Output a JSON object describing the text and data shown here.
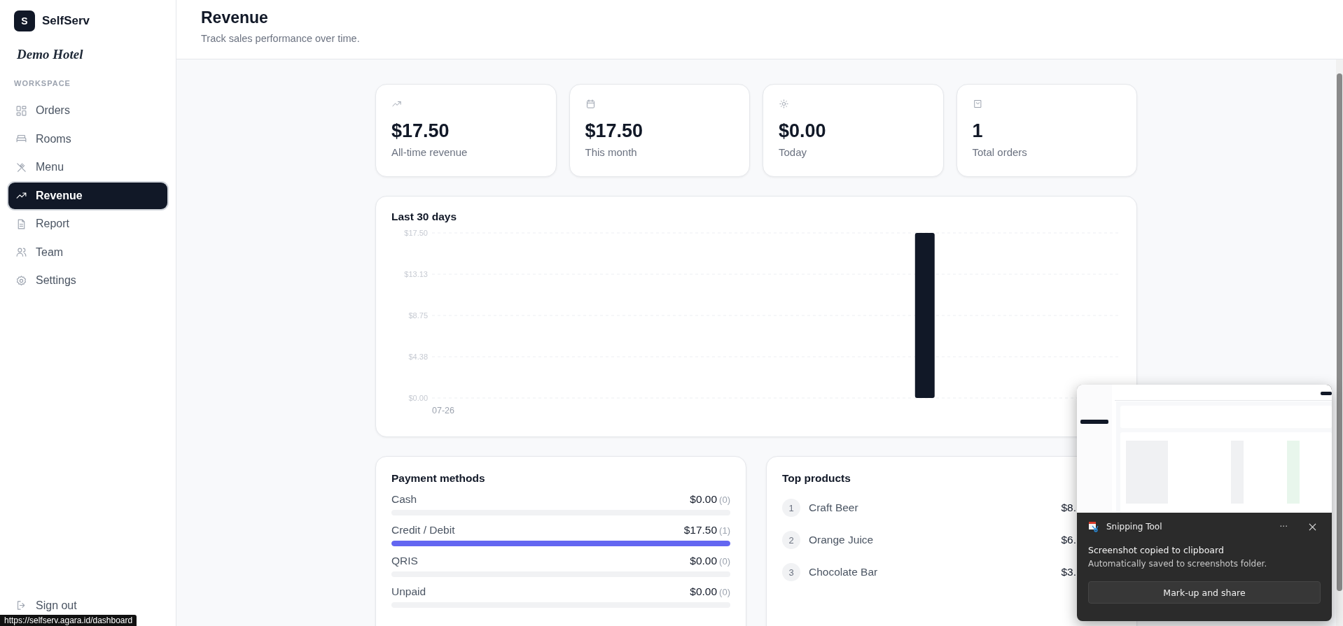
{
  "sidebar": {
    "brand": {
      "initial": "S",
      "name": "SelfServ"
    },
    "property": "Demo Hotel",
    "section": "WORKSPACE",
    "items": [
      {
        "label": "Orders",
        "selected": false
      },
      {
        "label": "Rooms",
        "selected": false
      },
      {
        "label": "Menu",
        "selected": false
      },
      {
        "label": "Revenue",
        "selected": true
      },
      {
        "label": "Report",
        "selected": false
      },
      {
        "label": "Team",
        "selected": false
      },
      {
        "label": "Settings",
        "selected": false
      }
    ],
    "sign_out": "Sign out"
  },
  "header": {
    "title": "Revenue",
    "subtitle": "Track sales performance over time."
  },
  "stats": [
    {
      "value": "$17.50",
      "label": "All-time revenue"
    },
    {
      "value": "$17.50",
      "label": "This month"
    },
    {
      "value": "$0.00",
      "label": "Today"
    },
    {
      "value": "1",
      "label": "Total orders"
    }
  ],
  "chart": {
    "title": "Last 30 days",
    "chart_data": {
      "type": "bar",
      "categories": [
        "07-26",
        null,
        null,
        null,
        null,
        null,
        null,
        null,
        null,
        null,
        null,
        null,
        null,
        null,
        null,
        null,
        null,
        null,
        null,
        null,
        null,
        null,
        null,
        null,
        null,
        null,
        null,
        null,
        null,
        null
      ],
      "grid": true,
      "series": [
        {
          "color": "#111827",
          "values": [
            0,
            0,
            0,
            0,
            0,
            0,
            0,
            0,
            0,
            0,
            0,
            0,
            0,
            0,
            0,
            0,
            0,
            0,
            0,
            0,
            0,
            17.5,
            0,
            0,
            0,
            0,
            0,
            0,
            0,
            0
          ]
        }
      ],
      "ylim": [
        0,
        17.5
      ],
      "yticks": [
        {
          "value": 0,
          "label": "$0.00"
        },
        {
          "value": 4.375,
          "label": "$4.38"
        },
        {
          "value": 8.75,
          "label": "$8.75"
        },
        {
          "value": 13.125,
          "label": "$13.13"
        },
        {
          "value": 17.5,
          "label": "$17.50"
        }
      ]
    }
  },
  "payment_methods": {
    "title": "Payment methods",
    "rows": [
      {
        "name": "Cash",
        "amount": "$0.00",
        "count": "(0)",
        "level": 0
      },
      {
        "name": "Credit / Debit",
        "amount": "$17.50",
        "count": "(1)",
        "level": 1
      },
      {
        "name": "QRIS",
        "amount": "$0.00",
        "count": "(0)",
        "level": 0
      },
      {
        "name": "Unpaid",
        "amount": "$0.00",
        "count": "(0)",
        "level": 0
      }
    ]
  },
  "top_products": {
    "title": "Top products",
    "rows": [
      {
        "rank": "1",
        "name": "Craft Beer",
        "amount": "$8."
      },
      {
        "rank": "2",
        "name": "Orange Juice",
        "amount": "$6."
      },
      {
        "rank": "3",
        "name": "Chocolate Bar",
        "amount": "$3."
      }
    ]
  },
  "toast": {
    "app": "Snipping Tool",
    "menu": "···",
    "title": "Screenshot copied to clipboard",
    "message": "Automatically saved to screenshots folder.",
    "button": "Mark-up and share"
  },
  "status_url": "https://selfserv.agara.id/dashboard"
}
